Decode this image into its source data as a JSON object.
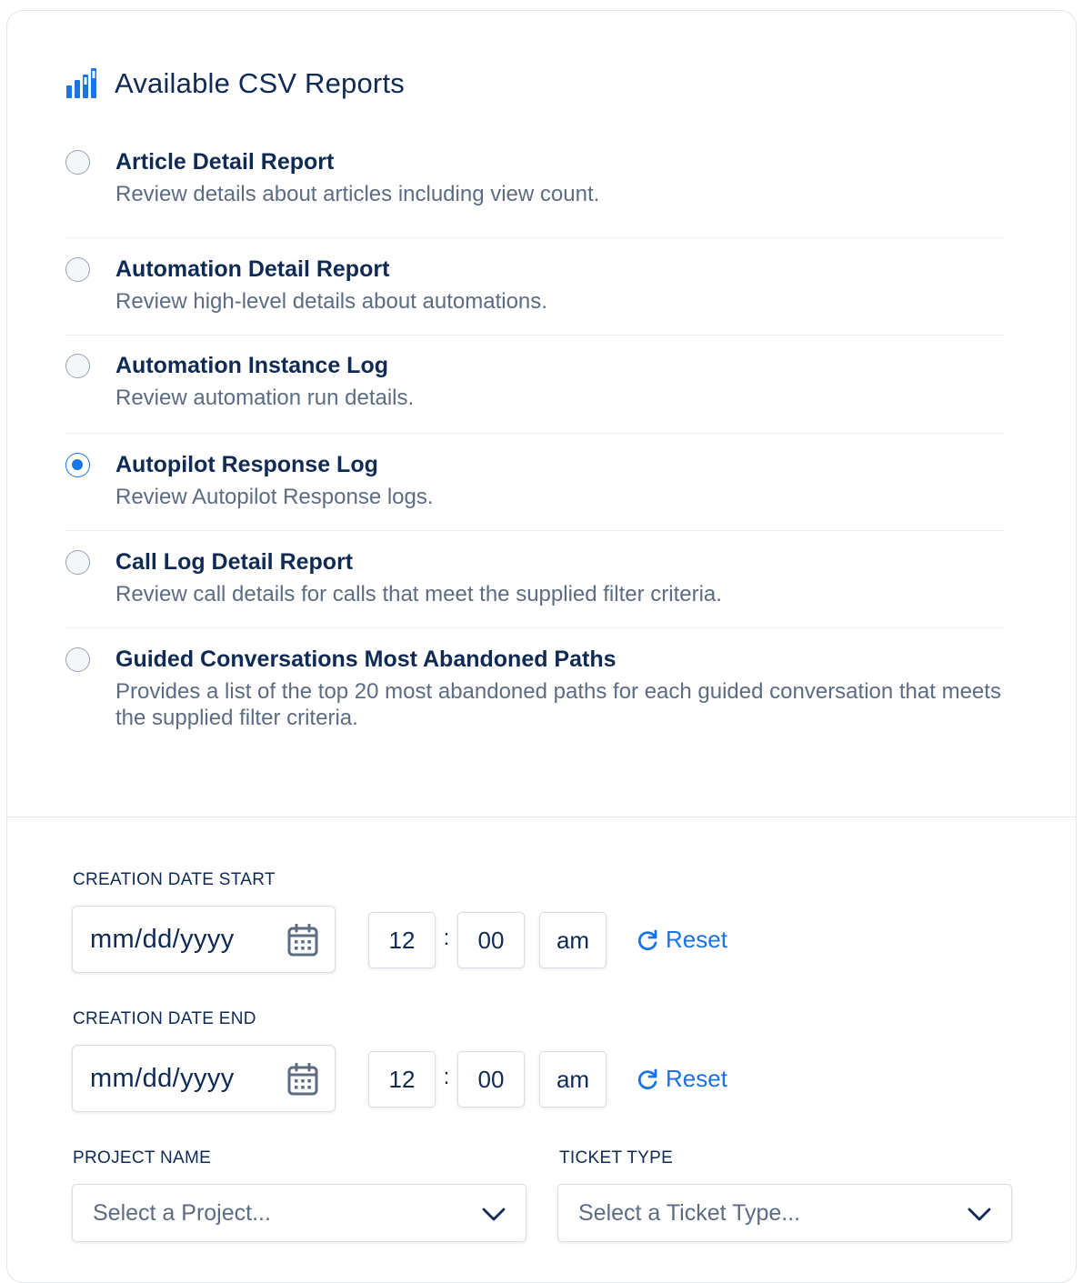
{
  "header": {
    "title": "Available CSV Reports",
    "icon": "bar-chart-icon",
    "icon_color": "#1a73e8"
  },
  "reports": [
    {
      "title": "Article Detail Report",
      "description": "Review details about articles including view count.",
      "selected": false
    },
    {
      "title": "Automation Detail Report",
      "description": "Review high-level details about automations.",
      "selected": false
    },
    {
      "title": "Automation Instance Log",
      "description": "Review automation run details.",
      "selected": false
    },
    {
      "title": "Autopilot Response Log",
      "description": "Review Autopilot Response logs.",
      "selected": true
    },
    {
      "title": "Call Log Detail Report",
      "description": "Review call details for calls that meet the supplied filter criteria.",
      "selected": false
    },
    {
      "title": "Guided Conversations Most Abandoned Paths",
      "description": "Provides a list of the top 20 most abandoned paths for each guided conversation that meets the supplied filter criteria.",
      "selected": false
    }
  ],
  "filters": {
    "start": {
      "label": "CREATION DATE START",
      "date_placeholder": "mm/dd/yyyy",
      "hour": "12",
      "minute": "00",
      "ampm": "am",
      "reset_label": "Reset"
    },
    "end": {
      "label": "CREATION DATE END",
      "date_placeholder": "mm/dd/yyyy",
      "hour": "12",
      "minute": "00",
      "ampm": "am",
      "reset_label": "Reset"
    },
    "project": {
      "label": "PROJECT NAME",
      "placeholder": "Select a Project..."
    },
    "ticket_type": {
      "label": "TICKET TYPE",
      "placeholder": "Select a Ticket Type..."
    },
    "time_separator": ":"
  },
  "colors": {
    "accent": "#1a73e8",
    "title_text": "#0f2a54",
    "muted_text": "#5c6c82",
    "border": "#d9dde3"
  }
}
